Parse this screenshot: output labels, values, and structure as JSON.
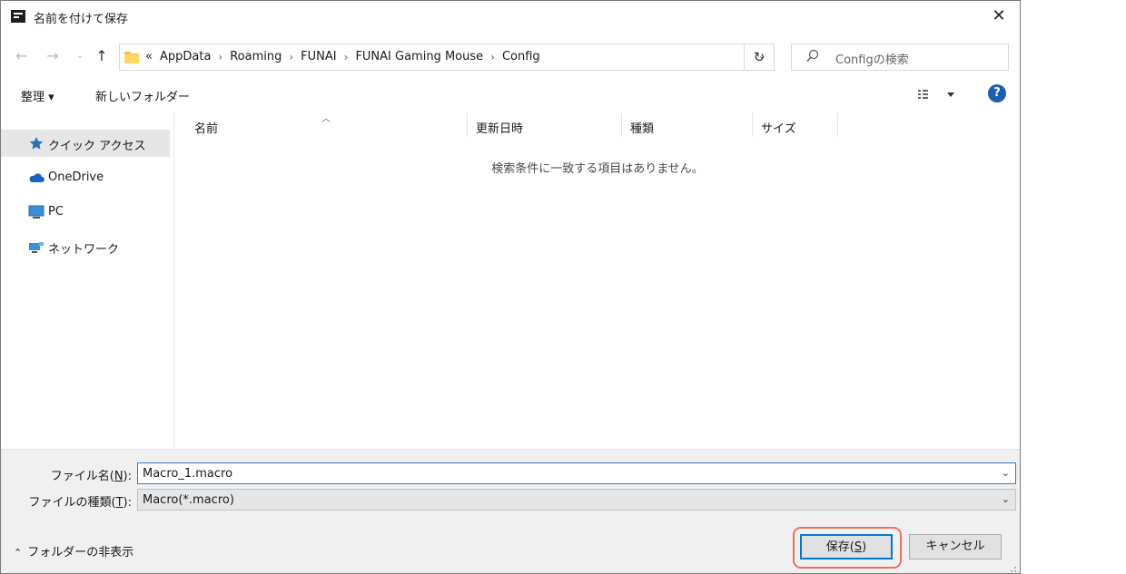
{
  "window": {
    "title": "名前を付けて保存",
    "close_label": "✕"
  },
  "address": {
    "overflow": "«",
    "crumbs": [
      "AppData",
      "Roaming",
      "FUNAI",
      "FUNAI Gaming Mouse",
      "Config"
    ]
  },
  "search": {
    "placeholder": "Configの検索"
  },
  "toolbar": {
    "organize": "整理 ▾",
    "new_folder": "新しいフォルダー"
  },
  "sidebar": {
    "items": [
      {
        "label": "クイック アクセス",
        "icon": "star-icon"
      },
      {
        "label": "OneDrive",
        "icon": "cloud-icon"
      },
      {
        "label": "PC",
        "icon": "monitor-icon"
      },
      {
        "label": "ネットワーク",
        "icon": "network-icon"
      }
    ]
  },
  "list": {
    "columns": [
      "名前",
      "更新日時",
      "種類",
      "サイズ"
    ],
    "empty_message": "検索条件に一致する項目はありません。"
  },
  "form": {
    "filename_label": "ファイル名(",
    "filename_key": "N",
    "filename_label_end": "):",
    "filename_value": "Macro_1.macro",
    "filetype_label": "ファイルの種類(",
    "filetype_key": "T",
    "filetype_label_end": "):",
    "filetype_value": "Macro(*.macro)"
  },
  "footer": {
    "hide_folders": "フォルダーの非表示",
    "save_label": "保存(",
    "save_key": "S",
    "save_label_end": ")",
    "cancel_label": "キャンセル"
  },
  "colors": {
    "accent": "#0078d7",
    "highlight": "#e9735a",
    "folder": "#f5c542"
  }
}
